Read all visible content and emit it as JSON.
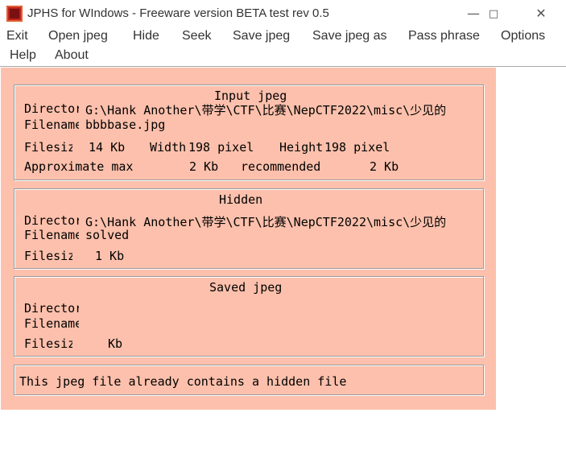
{
  "window": {
    "title": "JPHS for WIndows - Freeware version BETA test rev 0.5",
    "icons": {
      "app": "jphs-app-icon",
      "minimize": "minimize-icon",
      "maximize": "maximize-icon",
      "close": "close-icon"
    }
  },
  "menu": {
    "exit": "Exit",
    "open_jpeg": "Open jpeg",
    "hide": "Hide",
    "seek": "Seek",
    "save_jpeg": "Save jpeg",
    "save_jpeg_as": "Save jpeg as",
    "pass_phrase": "Pass phrase",
    "options": "Options",
    "help": "Help",
    "about": "About"
  },
  "input_jpeg": {
    "heading": "Input jpeg",
    "directory_label": "Directory",
    "directory_value": "G:\\Hank Another\\带学\\CTF\\比赛\\NepCTF2022\\misc\\少见的",
    "filename_label": "Filename",
    "filename_value": "bbbbase.jpg",
    "filesize_label": "Filesize",
    "filesize_value": "14 Kb",
    "width_label": "Width",
    "width_value": "198 pixel",
    "height_label": "Height",
    "height_value": "198 pixel",
    "approx_label": "Approximate max",
    "approx_value": "2 Kb",
    "recommended_label": "recommended",
    "recommended_value": "2 Kb"
  },
  "hidden": {
    "heading": "Hidden",
    "directory_label": "Directory",
    "directory_value": "G:\\Hank Another\\带学\\CTF\\比赛\\NepCTF2022\\misc\\少见的",
    "filename_label": "Filename",
    "filename_value": "solved",
    "filesize_label": "Filesize",
    "filesize_value": "1 Kb"
  },
  "saved_jpeg": {
    "heading": "Saved jpeg",
    "directory_label": "Directory",
    "filename_label": "Filename",
    "filesize_label": "Filesize",
    "filesize_unit": "Kb"
  },
  "status": {
    "message": "This jpeg file already contains a hidden file"
  }
}
